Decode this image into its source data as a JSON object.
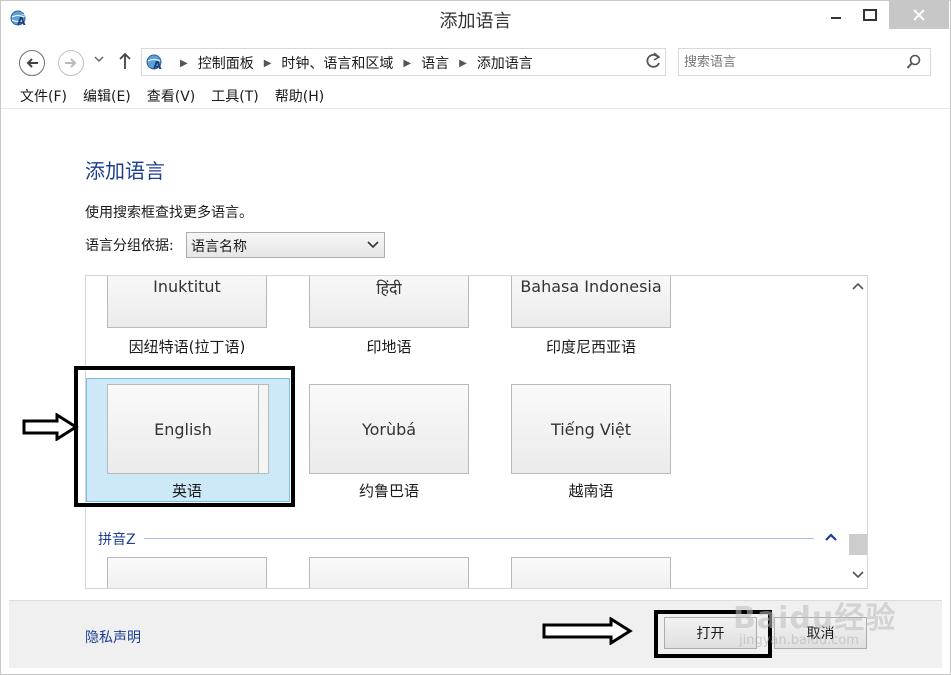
{
  "window": {
    "title": "添加语言"
  },
  "address": {
    "crumbs": [
      "控制面板",
      "时钟、语言和区域",
      "语言",
      "添加语言"
    ]
  },
  "search": {
    "placeholder": "搜索语言"
  },
  "menu": [
    "文件(F)",
    "编辑(E)",
    "查看(V)",
    "工具(T)",
    "帮助(H)"
  ],
  "page": {
    "heading": "添加语言",
    "description": "使用搜索框查找更多语言。",
    "group_label": "语言分组依据:",
    "group_value": "语言名称"
  },
  "languages": {
    "row1": [
      {
        "native": "Inuktitut",
        "caption": "因纽特语(拉丁语)"
      },
      {
        "native": "हिंदी",
        "caption": "印地语"
      },
      {
        "native": "Bahasa Indonesia",
        "caption": "印度尼西亚语"
      }
    ],
    "row2": [
      {
        "native": "English",
        "caption": "英语",
        "selected": true
      },
      {
        "native": "Yorùbá",
        "caption": "约鲁巴语"
      },
      {
        "native": "Tiếng Việt",
        "caption": "越南语"
      }
    ],
    "section_label": "拼音Z"
  },
  "bottom": {
    "privacy": "隐私声明",
    "open": "打开",
    "cancel": "取消"
  },
  "watermark": {
    "brand": "Baidu经验",
    "url": "jingyan.baidu.com"
  },
  "colors": {
    "accent_blue": "#1e3e90",
    "selected_bg": "#cde8f7",
    "close_btn": "#c7c7c7"
  }
}
